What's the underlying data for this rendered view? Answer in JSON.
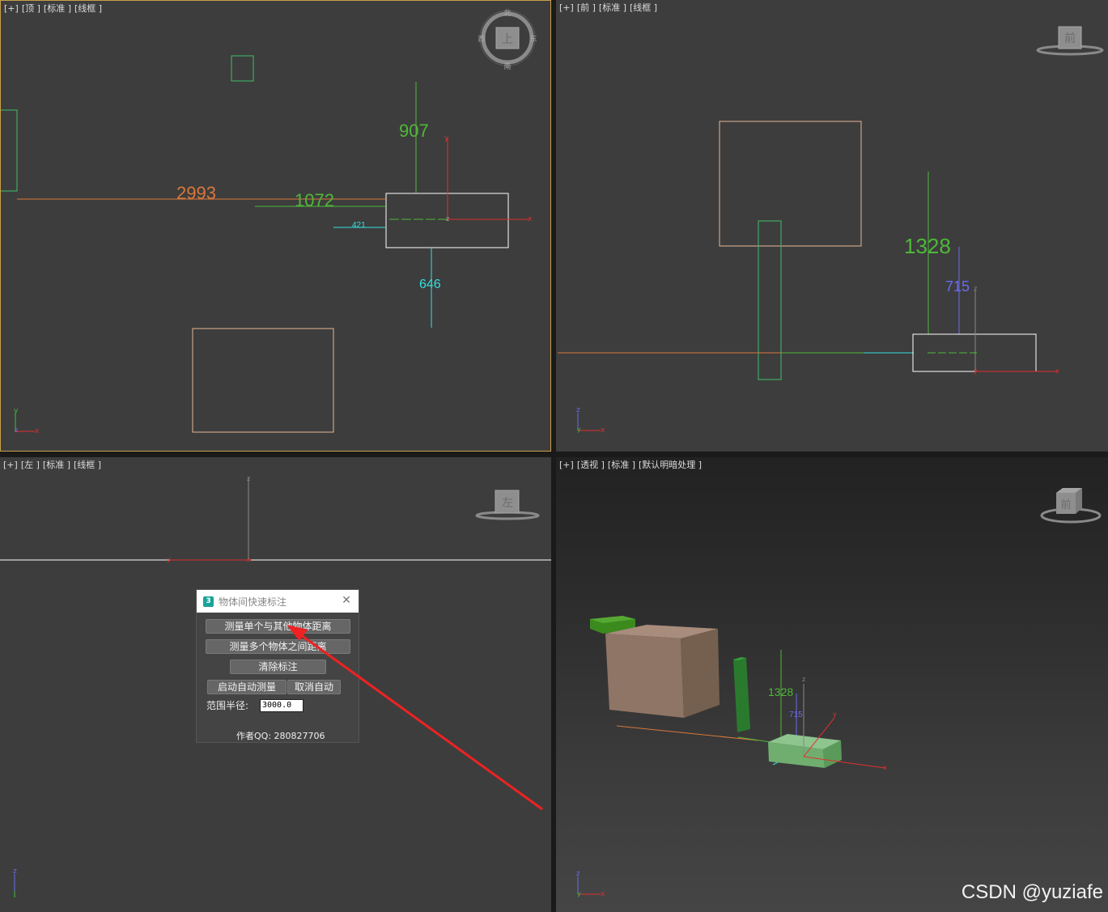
{
  "viewports": {
    "top": {
      "labels": [
        "[+]",
        "[顶 ]",
        "[标准 ]",
        "[线框 ]"
      ],
      "dims": {
        "d907": "907",
        "d2993": "2993",
        "d1072": "1072",
        "d421": "421",
        "d646": "646"
      },
      "compass": {
        "north": "北",
        "south": "南",
        "east": "东",
        "west": "西",
        "face": "上"
      }
    },
    "front": {
      "labels": [
        "[+]",
        "[前 ]",
        "[标准 ]",
        "[线框 ]"
      ],
      "dims": {
        "d1328": "1328",
        "d715": "715"
      },
      "cube_face": "前"
    },
    "left": {
      "labels": [
        "[+]",
        "[左 ]",
        "[标准 ]",
        "[线框 ]"
      ],
      "cube_face": "左"
    },
    "perspective": {
      "labels": [
        "[+]",
        "[透视 ]",
        "[标准 ]",
        "[默认明暗处理 ]"
      ],
      "dims": {
        "d1328": "1328",
        "d715": "715"
      },
      "cube_face": "前"
    }
  },
  "axis_letters": {
    "x": "x",
    "y": "y",
    "z": "z"
  },
  "dialog": {
    "logo": "3",
    "title": "物体间快速标注",
    "btn_single": "测量单个与其他物体距离",
    "btn_multi": "测量多个物体之间距离",
    "btn_clear": "清除标注",
    "btn_auto_start": "启动自动测量",
    "btn_auto_cancel": "取消自动",
    "radius_label": "范围半径:",
    "radius_value": "3000.0",
    "author": "作者QQ: 280827706"
  },
  "watermark": "CSDN @yuziafe",
  "colors": {
    "orange": "#d9773a",
    "green": "#4fb83a",
    "cyan": "#35e0e0",
    "blue": "#6a6af0",
    "red": "#e03030",
    "frame": "#c9a04a"
  }
}
